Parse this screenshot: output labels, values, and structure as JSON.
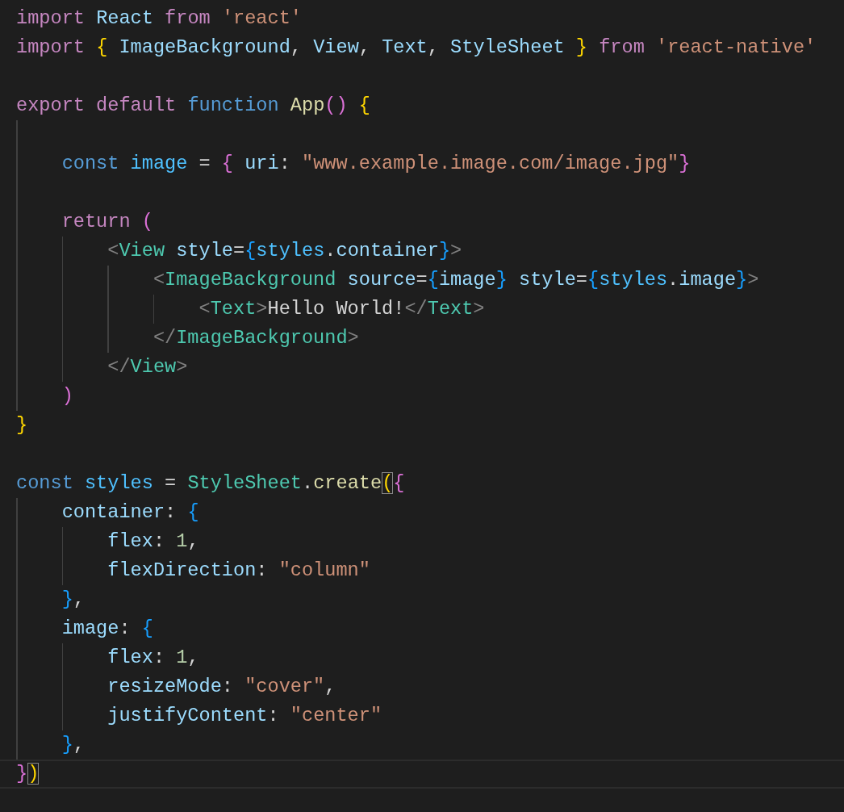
{
  "editor": {
    "lines": [
      {
        "current": false,
        "tokens": [
          {
            "kind": "kw",
            "text": "import "
          },
          {
            "kind": "var",
            "text": "React "
          },
          {
            "kind": "kw",
            "text": "from "
          },
          {
            "kind": "str",
            "text": "'react'"
          }
        ]
      },
      {
        "current": false,
        "tokens": [
          {
            "kind": "kw",
            "text": "import "
          },
          {
            "kind": "b1",
            "text": "{ "
          },
          {
            "kind": "var",
            "text": "ImageBackground"
          },
          {
            "kind": "plain",
            "text": ", "
          },
          {
            "kind": "var",
            "text": "View"
          },
          {
            "kind": "plain",
            "text": ", "
          },
          {
            "kind": "var",
            "text": "Text"
          },
          {
            "kind": "plain",
            "text": ", "
          },
          {
            "kind": "var",
            "text": "StyleSheet "
          },
          {
            "kind": "b1",
            "text": "} "
          },
          {
            "kind": "kw",
            "text": "from "
          },
          {
            "kind": "str",
            "text": "'react-native'"
          }
        ]
      },
      {
        "current": false
      },
      {
        "current": false,
        "tokens": [
          {
            "kind": "kw",
            "text": "export default "
          },
          {
            "kind": "store",
            "text": "function "
          },
          {
            "kind": "fn",
            "text": "App"
          },
          {
            "kind": "b2",
            "text": "() "
          },
          {
            "kind": "b1",
            "text": "{"
          }
        ],
        "children": [
          {
            "current": false
          },
          {
            "current": false,
            "tokens": [
              {
                "kind": "store",
                "text": "const "
              },
              {
                "kind": "const",
                "text": "image "
              },
              {
                "kind": "plain",
                "text": "= "
              },
              {
                "kind": "b2",
                "text": "{ "
              },
              {
                "kind": "var",
                "text": "uri"
              },
              {
                "kind": "plain",
                "text": ": "
              },
              {
                "kind": "str",
                "text": "\"www.example.image.com/image.jpg\""
              },
              {
                "kind": "b2",
                "text": "}"
              }
            ]
          },
          {
            "current": false
          },
          {
            "current": false,
            "tokens": [
              {
                "kind": "kw",
                "text": "return "
              },
              {
                "kind": "b2",
                "text": "("
              }
            ],
            "children": [
              {
                "current": false,
                "tokens": [
                  {
                    "kind": "tagp",
                    "text": "<"
                  },
                  {
                    "kind": "type",
                    "text": "View "
                  },
                  {
                    "kind": "var",
                    "text": "style"
                  },
                  {
                    "kind": "plain",
                    "text": "="
                  },
                  {
                    "kind": "b3",
                    "text": "{"
                  },
                  {
                    "kind": "const",
                    "text": "styles"
                  },
                  {
                    "kind": "plain",
                    "text": "."
                  },
                  {
                    "kind": "var",
                    "text": "container"
                  },
                  {
                    "kind": "b3",
                    "text": "}"
                  },
                  {
                    "kind": "tagp",
                    "text": ">"
                  }
                ],
                "children": [
                  {
                    "current": false,
                    "tokens": [
                      {
                        "kind": "tagp",
                        "text": "<"
                      },
                      {
                        "kind": "type",
                        "text": "ImageBackground "
                      },
                      {
                        "kind": "var",
                        "text": "source"
                      },
                      {
                        "kind": "plain",
                        "text": "="
                      },
                      {
                        "kind": "b3",
                        "text": "{"
                      },
                      {
                        "kind": "var",
                        "text": "image"
                      },
                      {
                        "kind": "b3",
                        "text": "} "
                      },
                      {
                        "kind": "var",
                        "text": "style"
                      },
                      {
                        "kind": "plain",
                        "text": "="
                      },
                      {
                        "kind": "b3",
                        "text": "{"
                      },
                      {
                        "kind": "const",
                        "text": "styles"
                      },
                      {
                        "kind": "plain",
                        "text": "."
                      },
                      {
                        "kind": "var",
                        "text": "image"
                      },
                      {
                        "kind": "b3",
                        "text": "}"
                      },
                      {
                        "kind": "tagp",
                        "text": ">"
                      }
                    ],
                    "children": [
                      {
                        "current": false,
                        "tokens": [
                          {
                            "kind": "tagp",
                            "text": "<"
                          },
                          {
                            "kind": "type",
                            "text": "Text"
                          },
                          {
                            "kind": "tagp",
                            "text": ">"
                          },
                          {
                            "kind": "plain",
                            "text": "Hello World!"
                          },
                          {
                            "kind": "tagp",
                            "text": "</"
                          },
                          {
                            "kind": "type",
                            "text": "Text"
                          },
                          {
                            "kind": "tagp",
                            "text": ">"
                          }
                        ]
                      }
                    ]
                  },
                  {
                    "current": false,
                    "tokens": [
                      {
                        "kind": "tagp",
                        "text": "</"
                      },
                      {
                        "kind": "type",
                        "text": "ImageBackground"
                      },
                      {
                        "kind": "tagp",
                        "text": ">"
                      }
                    ]
                  }
                ]
              },
              {
                "current": false,
                "tokens": [
                  {
                    "kind": "tagp",
                    "text": "</"
                  },
                  {
                    "kind": "type",
                    "text": "View"
                  },
                  {
                    "kind": "tagp",
                    "text": ">"
                  }
                ]
              }
            ]
          },
          {
            "current": false,
            "tokens": [
              {
                "kind": "b2",
                "text": ")"
              }
            ]
          }
        ]
      },
      {
        "current": false,
        "tokens": [
          {
            "kind": "b1",
            "text": "}"
          }
        ]
      },
      {
        "current": false
      },
      {
        "current": false,
        "tokens": [
          {
            "kind": "store",
            "text": "const "
          },
          {
            "kind": "const",
            "text": "styles "
          },
          {
            "kind": "plain",
            "text": "= "
          },
          {
            "kind": "type",
            "text": "StyleSheet"
          },
          {
            "kind": "plain",
            "text": "."
          },
          {
            "kind": "fn",
            "text": "create"
          },
          {
            "kind": "b1match",
            "text": "("
          },
          {
            "kind": "b2",
            "text": "{"
          }
        ],
        "children": [
          {
            "current": false,
            "tokens": [
              {
                "kind": "var",
                "text": "container"
              },
              {
                "kind": "plain",
                "text": ": "
              },
              {
                "kind": "b3",
                "text": "{"
              }
            ],
            "children": [
              {
                "current": false,
                "tokens": [
                  {
                    "kind": "var",
                    "text": "flex"
                  },
                  {
                    "kind": "plain",
                    "text": ": "
                  },
                  {
                    "kind": "num",
                    "text": "1"
                  },
                  {
                    "kind": "plain",
                    "text": ","
                  }
                ]
              },
              {
                "current": false,
                "tokens": [
                  {
                    "kind": "var",
                    "text": "flexDirection"
                  },
                  {
                    "kind": "plain",
                    "text": ": "
                  },
                  {
                    "kind": "str",
                    "text": "\"column\""
                  }
                ]
              }
            ]
          },
          {
            "current": false,
            "tokens": [
              {
                "kind": "b3",
                "text": "}"
              },
              {
                "kind": "plain",
                "text": ","
              }
            ]
          },
          {
            "current": false,
            "tokens": [
              {
                "kind": "var",
                "text": "image"
              },
              {
                "kind": "plain",
                "text": ": "
              },
              {
                "kind": "b3",
                "text": "{"
              }
            ],
            "children": [
              {
                "current": false,
                "tokens": [
                  {
                    "kind": "var",
                    "text": "flex"
                  },
                  {
                    "kind": "plain",
                    "text": ": "
                  },
                  {
                    "kind": "num",
                    "text": "1"
                  },
                  {
                    "kind": "plain",
                    "text": ","
                  }
                ]
              },
              {
                "current": false,
                "tokens": [
                  {
                    "kind": "var",
                    "text": "resizeMode"
                  },
                  {
                    "kind": "plain",
                    "text": ": "
                  },
                  {
                    "kind": "str",
                    "text": "\"cover\""
                  },
                  {
                    "kind": "plain",
                    "text": ","
                  }
                ]
              },
              {
                "current": false,
                "tokens": [
                  {
                    "kind": "var",
                    "text": "justifyContent"
                  },
                  {
                    "kind": "plain",
                    "text": ": "
                  },
                  {
                    "kind": "str",
                    "text": "\"center\""
                  }
                ]
              }
            ]
          },
          {
            "current": false,
            "tokens": [
              {
                "kind": "b3",
                "text": "}"
              },
              {
                "kind": "plain",
                "text": ","
              }
            ]
          }
        ]
      },
      {
        "current": true,
        "tokens": [
          {
            "kind": "b2",
            "text": "}"
          },
          {
            "kind": "b1match",
            "text": ")"
          }
        ]
      }
    ]
  }
}
